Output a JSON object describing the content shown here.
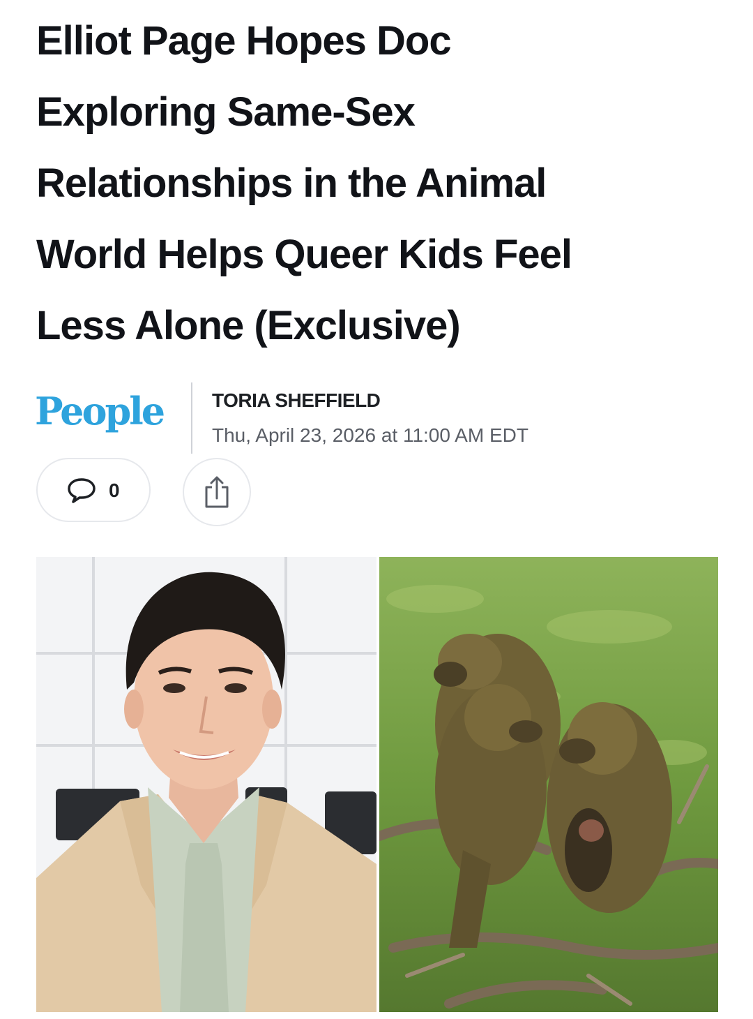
{
  "article": {
    "headline_lines": [
      "Elliot Page Hopes Doc",
      "Exploring Same-Sex",
      "Relationships in the Animal",
      "World Helps Queer Kids Feel",
      "Less Alone (Exclusive)"
    ]
  },
  "byline": {
    "publisher": "People",
    "author": "TORIA SHEFFIELD",
    "date": "Thu, April 23, 2026 at 11:00 AM EDT"
  },
  "actions": {
    "comment_count": "0",
    "comment_icon": "speech-bubble-icon",
    "share_icon": "share-icon"
  },
  "colors": {
    "publisher_brand": "#2ea3dd",
    "text": "#111318",
    "muted_text": "#5a5e66"
  }
}
